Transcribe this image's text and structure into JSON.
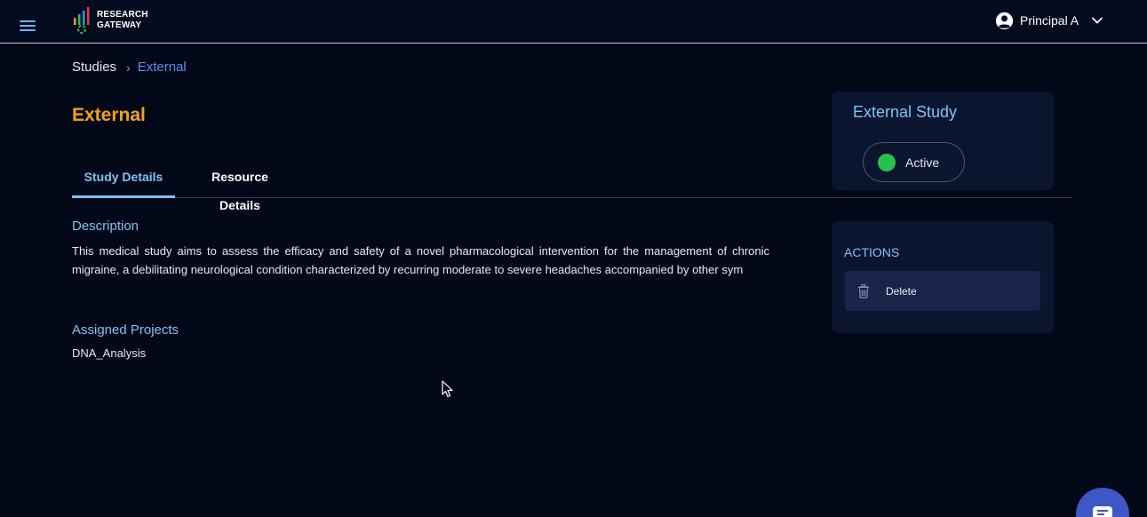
{
  "header": {
    "logo_line1": "RESEARCH",
    "logo_line2": "GATEWAY",
    "menu_icon": "hamburger-icon",
    "user_icon": "user-circle-icon",
    "user_name": "Principal A",
    "dropdown_icon": "chevron-down-icon"
  },
  "breadcrumb": {
    "root": "Studies",
    "separator": "›",
    "current": "External"
  },
  "page": {
    "title": "External"
  },
  "tabs": [
    {
      "label": "Study Details",
      "active": true
    },
    {
      "label": "Resource Details",
      "active": false
    }
  ],
  "details": {
    "description_label": "Description",
    "description_text": "This medical study aims to assess the efficacy and safety of a novel pharmacological intervention for the management of chronic migraine, a debilitating neurological condition characterized by recurring moderate to severe headaches accompanied by other sym",
    "projects_label": "Assigned Projects",
    "project": "DNA_Analysis"
  },
  "study_card": {
    "type": "External Study",
    "status": "Active",
    "status_color": "#27c24c"
  },
  "actions": {
    "title": "ACTIONS",
    "delete_label": "Delete",
    "delete_icon": "trash-icon"
  },
  "colors": {
    "background": "#020817",
    "accent_title": "#f0a21e",
    "accent_link": "#7dc3f4",
    "card": "#0b1530"
  }
}
